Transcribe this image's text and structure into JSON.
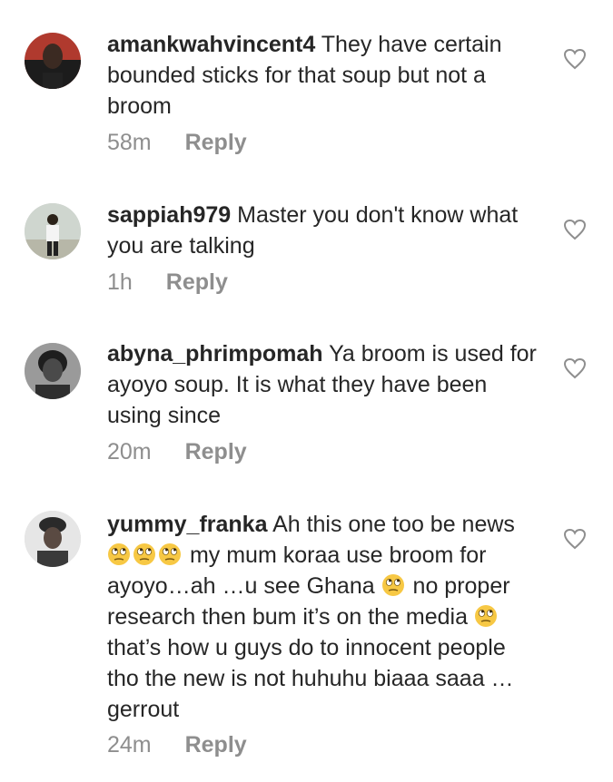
{
  "comments": [
    {
      "username": "amankwahvincent4",
      "text": "They have certain bounded sticks for that soup but not a broom",
      "time": "58m",
      "reply_label": "Reply",
      "avatar": "avatar-man-dark-red-background"
    },
    {
      "username": "sappiah979",
      "text": "Master you don't know what you are talking",
      "time": "1h",
      "reply_label": "Reply",
      "avatar": "avatar-man-standing-outdoors"
    },
    {
      "username": "abyna_phrimpomah",
      "text": "Ya broom is used for ayoyo soup. It is what they have been using since",
      "time": "20m",
      "reply_label": "Reply",
      "avatar": "avatar-woman-grayscale"
    },
    {
      "username": "yummy_franka",
      "text_parts": [
        "Ah this one too be news",
        "my mum koraa use broom for ayoyo…ah …u see Ghana",
        "no proper research then bum it’s on the media",
        "that’s how u guys do to innocent people tho the new is not huhuhu biaaa saaa …gerrout"
      ],
      "time": "24m",
      "reply_label": "Reply",
      "avatar": "avatar-woman-headwrap",
      "emoji": "face-with-rolling-eyes"
    }
  ],
  "colors": {
    "text": "#262626",
    "secondary": "#8e8e8e",
    "background": "#ffffff"
  },
  "icons": {
    "like": "heart-outline-icon"
  }
}
